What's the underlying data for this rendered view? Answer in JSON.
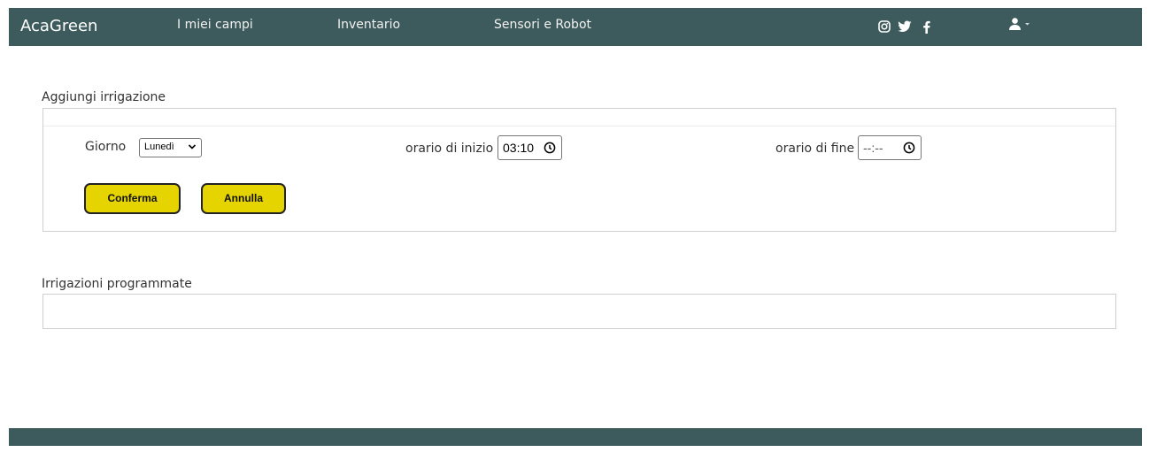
{
  "navbar": {
    "brand": "AcaGreen",
    "links": [
      "I miei campi",
      "Inventario",
      "Sensori e Robot"
    ],
    "social_icons": [
      "instagram-icon",
      "twitter-icon",
      "facebook-icon"
    ],
    "user_icon": "user-icon",
    "background": "#3d5a5c"
  },
  "add_section": {
    "title": "Aggiungi irrigazione",
    "day_label": "Giorno",
    "day_value": "Lunedì",
    "start_label": "orario di inizio",
    "start_value": "03:10",
    "end_label": "orario di fine",
    "end_value": "--:--",
    "confirm_label": "Conferma",
    "cancel_label": "Annulla",
    "button_color": "#e6d400"
  },
  "scheduled_section": {
    "title": "Irrigazioni programmate"
  }
}
